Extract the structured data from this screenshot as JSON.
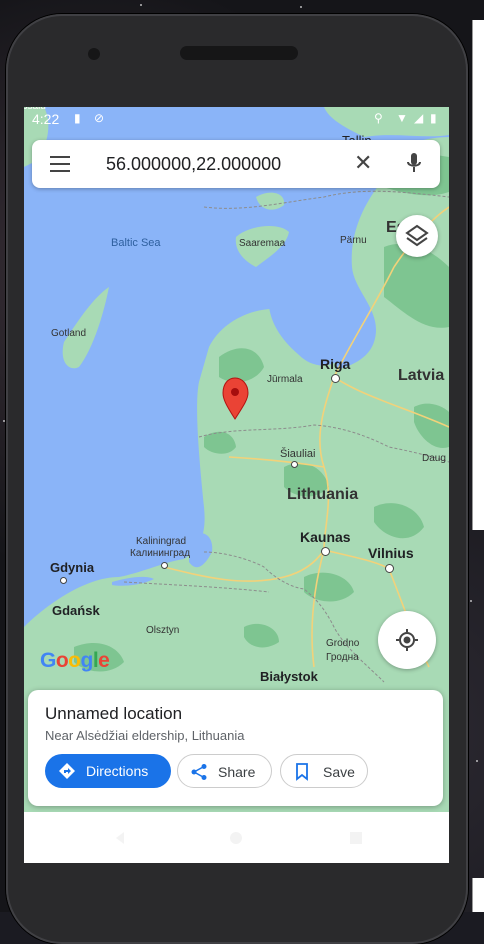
{
  "status_bar": {
    "time": "4:22"
  },
  "search": {
    "query": "56.000000,22.000000"
  },
  "map_labels": {
    "estonia_partial": "Es",
    "baltic_sea": "Baltic Sea",
    "saaremaa": "Saaremaa",
    "parnu": "Pärnu",
    "gotland": "Gotland",
    "riga": "Riga",
    "jurmala": "Jūrmala",
    "latvia": "Latvia",
    "siauliai": "Šiauliai",
    "daugavpils_partial": "Daug",
    "lithuania": "Lithuania",
    "kaliningrad": "Kaliningrad",
    "kaliningrad_ru": "Калининград",
    "kaunas": "Kaunas",
    "vilnius": "Vilnius",
    "gdynia": "Gdynia",
    "gdansk": "Gdańsk",
    "olsztyn": "Olsztyn",
    "grodno": "Grodno",
    "grodno_ru": "Гродна",
    "bialystok": "Białystok",
    "tallinn_partial": "Tallin",
    "top_left_partial": "psalu"
  },
  "logo": {
    "text": "Google"
  },
  "place_card": {
    "title": "Unnamed location",
    "subtitle": "Near Alsėdžiai eldership, Lithuania",
    "directions_label": "Directions",
    "share_label": "Share",
    "save_label": "Save"
  },
  "colors": {
    "water": "#8ab4f8",
    "land": "#a8dab5",
    "forest": "#7ec591",
    "accent": "#1a73e8",
    "pin": "#ea4335"
  }
}
